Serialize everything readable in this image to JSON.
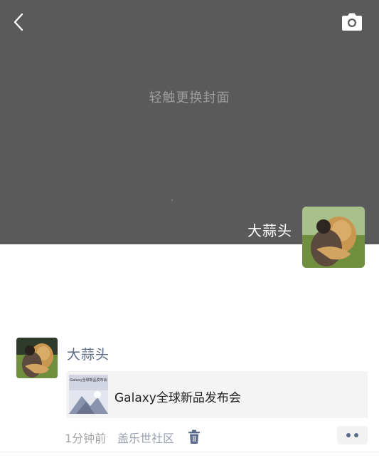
{
  "cover": {
    "hint": "轻触更换封面",
    "background_color": "#5a5a5a",
    "back_icon": "chevron-left-icon",
    "camera_icon": "camera-icon"
  },
  "profile": {
    "name": "大蒜头",
    "avatar_icon": "lion-hug-photo"
  },
  "post": {
    "author": "大蒜头",
    "avatar_icon": "lion-hug-photo",
    "share": {
      "title": "Galaxy全球新品发布会",
      "thumb_caption": "Galaxy全球新品发布会"
    },
    "time": "1分钟前",
    "location": "盖乐世社区",
    "delete_icon": "trash-icon",
    "more_icon": "more-dots-icon",
    "link_color": "#5a6b8c"
  }
}
